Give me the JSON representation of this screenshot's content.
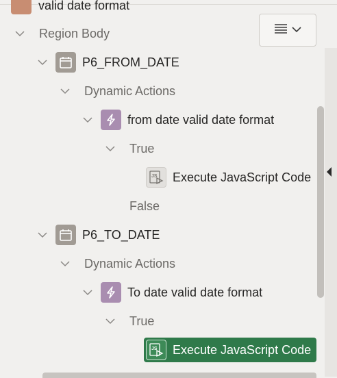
{
  "tree": {
    "top_partial": "valid date format",
    "region_body": "Region Body",
    "item1": {
      "name": "P6_FROM_DATE",
      "dynamic_actions": "Dynamic Actions",
      "action": "from date valid date format",
      "true_label": "True",
      "js_label": "Execute JavaScript Code",
      "false_label": "False"
    },
    "item2": {
      "name": "P6_TO_DATE",
      "dynamic_actions": "Dynamic Actions",
      "action": "To date valid date format",
      "true_label": "True",
      "js_label": "Execute JavaScript Code"
    }
  },
  "colors": {
    "selected": "#2f7a4a",
    "calendar_icon": "#a19b94",
    "dynamic_action_icon": "#a98db0"
  },
  "icons": {
    "menu": "hamburger-menu-icon",
    "menu_dropdown": "chevron-down-icon",
    "page_item": "calendar-icon",
    "dynamic_action": "lightning-icon",
    "javascript": "javascript-icon"
  }
}
